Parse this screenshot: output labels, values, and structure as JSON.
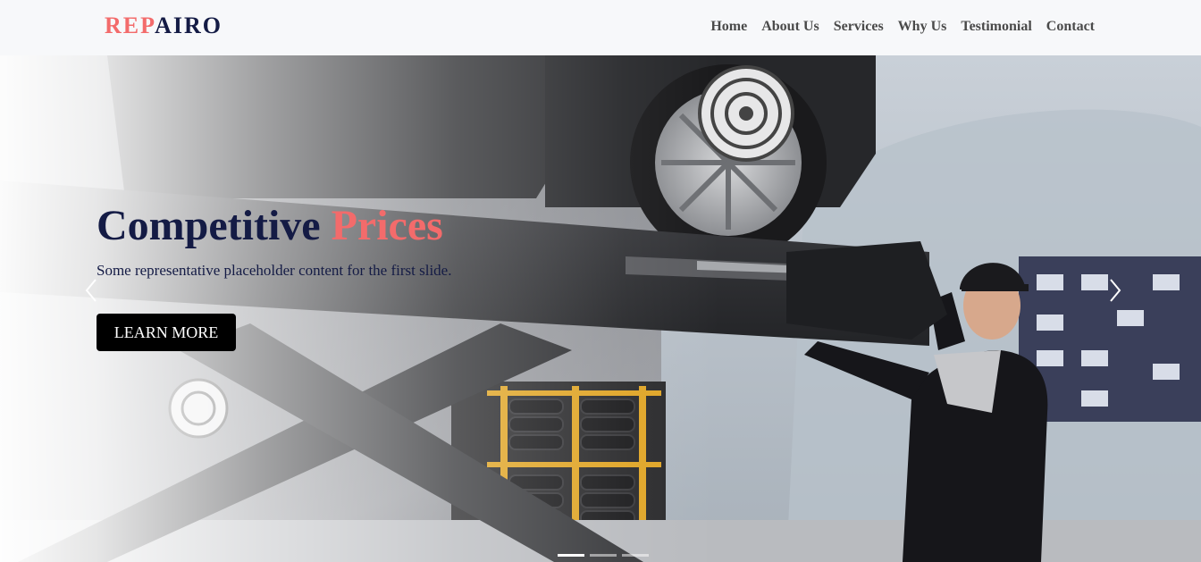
{
  "brand": {
    "part1": "REP",
    "part2": "AIRO"
  },
  "nav": {
    "items": [
      {
        "label": "Home"
      },
      {
        "label": "About Us"
      },
      {
        "label": "Services"
      },
      {
        "label": "Why Us"
      },
      {
        "label": "Testimonial"
      },
      {
        "label": "Contact"
      }
    ]
  },
  "hero": {
    "title_part1": "Competitive",
    "title_part2": "Prices",
    "subtitle": "Some representative placeholder content for the first slide.",
    "cta_label": "LEARN MORE",
    "prev_icon": "chevron-left-icon",
    "next_icon": "chevron-right-icon",
    "slides_count": 3,
    "active_slide": 1
  },
  "colors": {
    "accent": "#f36b6b",
    "navy": "#141b45",
    "nav_bg": "#f7f8fa",
    "nav_text": "#4a4a4a",
    "button_bg": "#000000"
  }
}
